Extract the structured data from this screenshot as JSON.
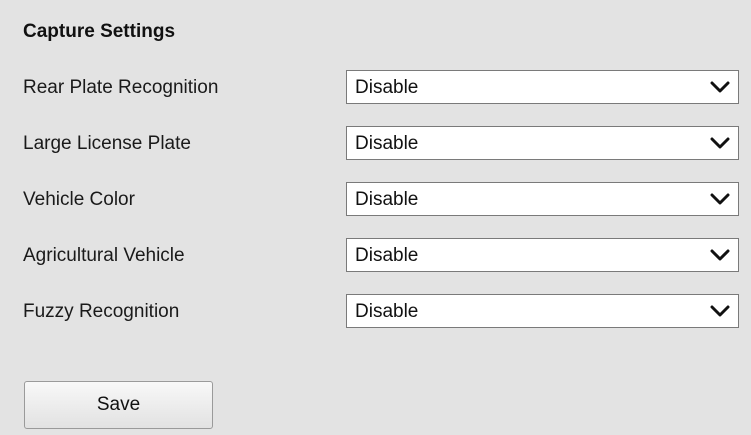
{
  "section": {
    "title": "Capture Settings"
  },
  "settings": [
    {
      "label": "Rear Plate Recognition",
      "value": "Disable"
    },
    {
      "label": "Large License Plate",
      "value": "Disable"
    },
    {
      "label": "Vehicle Color",
      "value": "Disable"
    },
    {
      "label": "Agricultural Vehicle",
      "value": "Disable"
    },
    {
      "label": "Fuzzy Recognition",
      "value": "Disable"
    }
  ],
  "actions": {
    "save_label": "Save"
  },
  "icons": {
    "dropdown": "chevron-down-icon"
  }
}
